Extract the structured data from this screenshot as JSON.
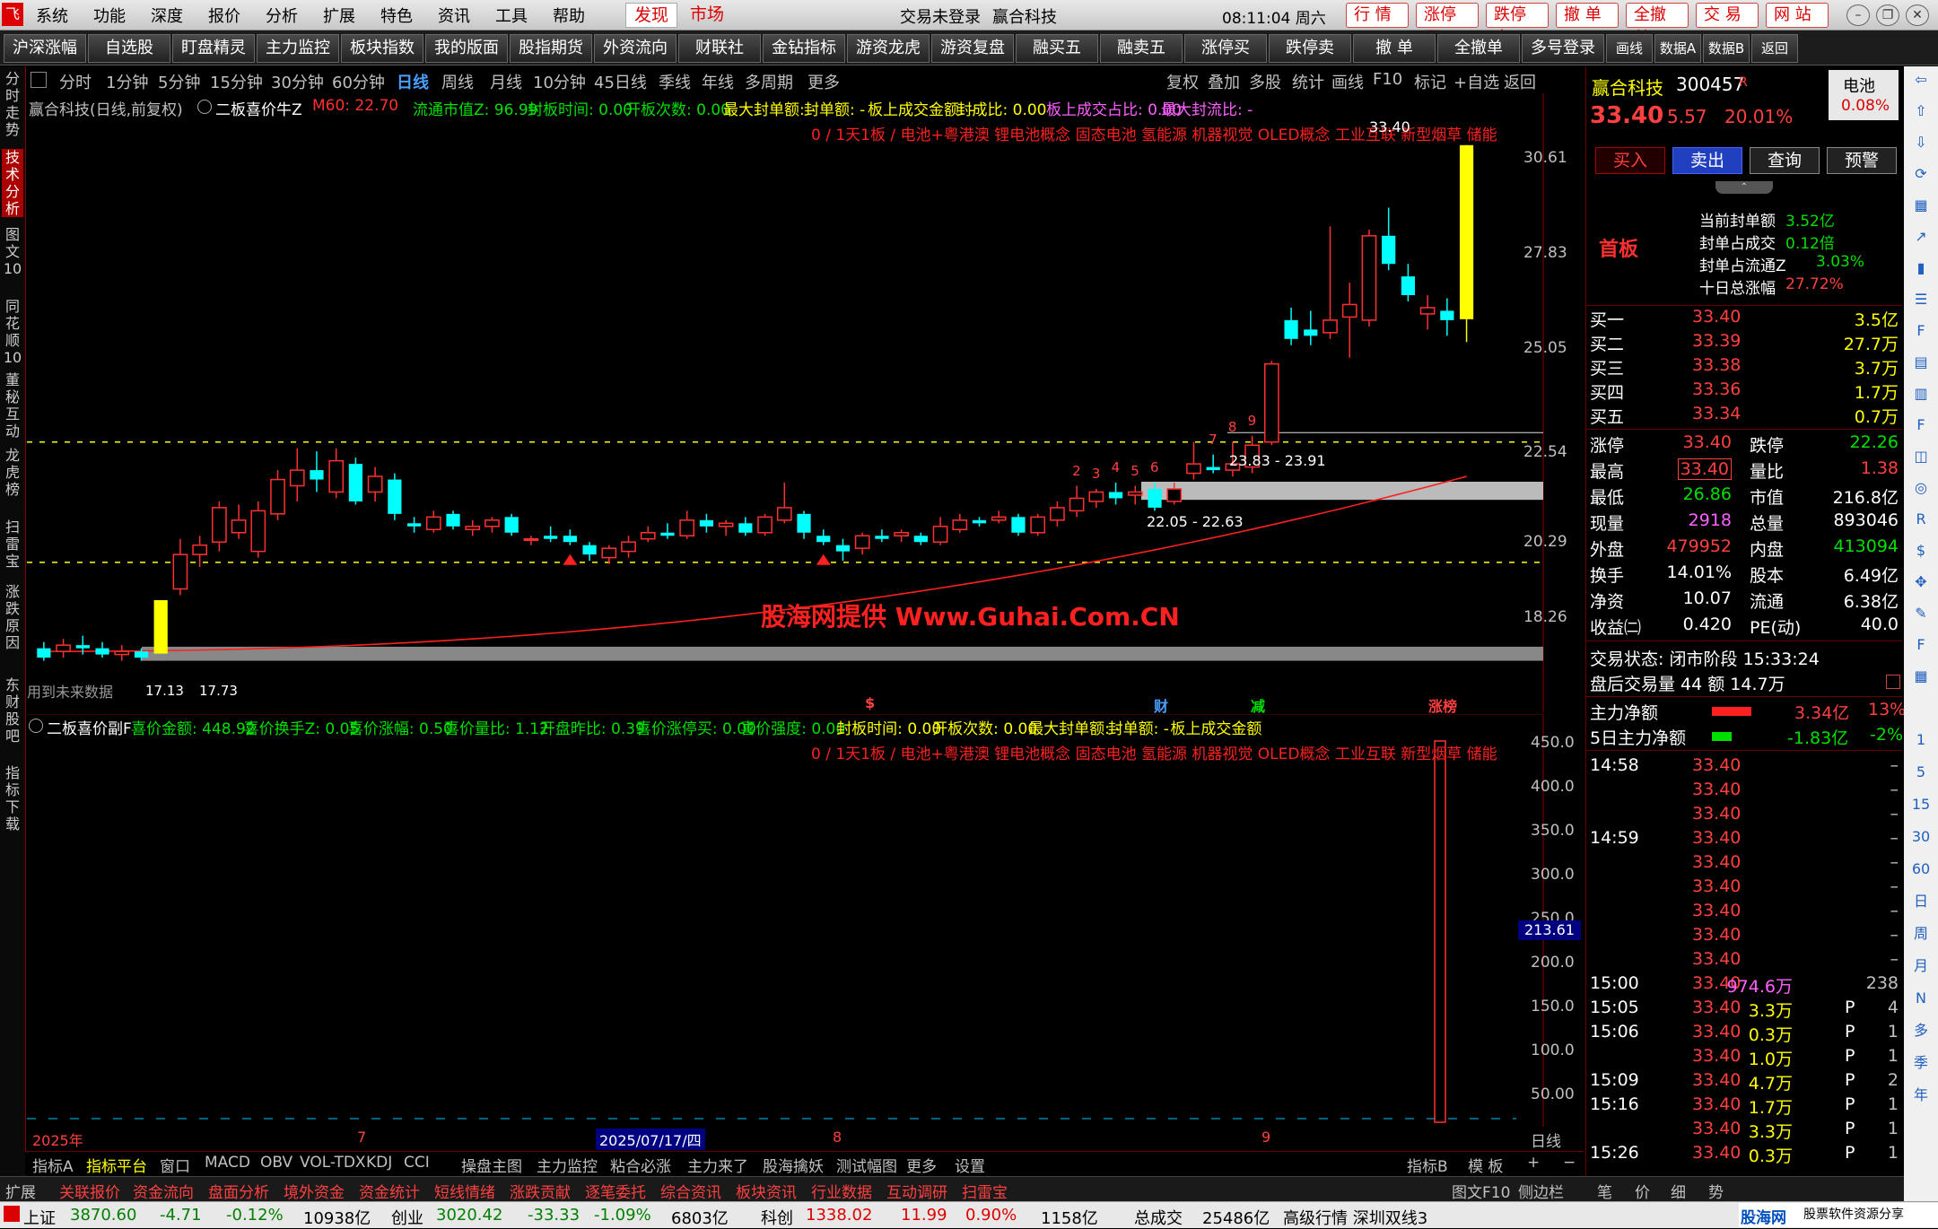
{
  "menu": {
    "items": [
      "系统",
      "功能",
      "深度",
      "报价",
      "分析",
      "扩展",
      "特色",
      "资讯",
      "工具",
      "帮助"
    ],
    "discover": "发现",
    "market": "市场",
    "login_status": "交易未登录",
    "stock_title": "赢合科技",
    "datetime": "08:11:04 周六",
    "right_buttons": [
      "行 情",
      "涨停买",
      "跌停卖",
      "撤 单",
      "全撤单",
      "交 易",
      "网 站"
    ]
  },
  "toolbar": {
    "buttons": [
      "沪深涨幅",
      "自选股",
      "盯盘精灵",
      "主力监控",
      "板块指数",
      "我的版面",
      "股指期货",
      "外资流向",
      "财联社",
      "金钻指标",
      "游资龙虎",
      "游资复盘",
      "融买五",
      "融卖五",
      "涨停买",
      "跌停卖",
      "撤 单",
      "全撤单",
      "多号登录",
      "画线",
      "数据A",
      "数据B",
      "返回"
    ]
  },
  "left_tabs": [
    "分时走势",
    "技术分析",
    "图文10",
    "同花顺10",
    "董秘互动",
    "龙虎榜",
    "扫雷宝",
    "涨跌原因",
    "东财股吧",
    "指标下载"
  ],
  "periods": {
    "items": [
      "分时",
      "1分钟",
      "5分钟",
      "15分钟",
      "30分钟",
      "60分钟",
      "日线",
      "周线",
      "月线",
      "10分钟",
      "45日线",
      "季线",
      "年线",
      "多周期",
      "更多"
    ],
    "active": "日线",
    "right_items": [
      "复权",
      "叠加",
      "多股",
      "统计",
      "画线",
      "F10",
      "标记",
      "+自选",
      "返回"
    ]
  },
  "main_chart": {
    "title": "赢合科技(日线,前复权)",
    "indicator": "二板喜价牛Z",
    "ma_label": "M60: 22.70",
    "info": [
      {
        "text": "流通市值Z: 96.99",
        "color": "#00e000"
      },
      {
        "text": "封板时间: 0.00",
        "color": "#00e000"
      },
      {
        "text": "开板次数: 0.00",
        "color": "#00e000"
      },
      {
        "text": "最大封单额: -",
        "color": "#ffff00"
      },
      {
        "text": "封单额: -",
        "color": "#ffff00"
      },
      {
        "text": "板上成交金额: -",
        "color": "#ffff00"
      },
      {
        "text": "封成比: 0.00",
        "color": "#ffff00"
      },
      {
        "text": "板上成交占比: 0.00",
        "color": "#ff60ff"
      },
      {
        "text": "最大封流比: -",
        "color": "#ff60ff"
      }
    ],
    "concepts": "0 / 1天1板 / 电池+粤港澳 锂电池概念 固态电池 氢能源 机器视觉 OLED概念 工业互联 新型烟草 储能",
    "y_ticks": [
      "30.61",
      "27.83",
      "25.05",
      "22.54",
      "20.29",
      "18.26"
    ],
    "peak_label": "33.40",
    "box1": "23.83 - 23.91",
    "box2": "22.05 - 22.63",
    "low_label": "17.13",
    "low_label2": "17.73",
    "future_label": "用到未来数据",
    "count_labels": [
      "7",
      "8",
      "9",
      "2",
      "3",
      "4",
      "5",
      "6"
    ],
    "watermark": "股海网提供 Www.Guhai.Com.CN",
    "markers": [
      "$",
      "财",
      "减",
      "涨榜"
    ]
  },
  "candles": [
    {
      "o": 17.3,
      "h": 17.5,
      "l": 16.9,
      "c": 17.0
    },
    {
      "o": 17.2,
      "h": 17.6,
      "l": 17.0,
      "c": 17.4
    },
    {
      "o": 17.4,
      "h": 17.7,
      "l": 17.1,
      "c": 17.3
    },
    {
      "o": 17.3,
      "h": 17.5,
      "l": 17.0,
      "c": 17.1
    },
    {
      "o": 17.1,
      "h": 17.4,
      "l": 16.9,
      "c": 17.2
    },
    {
      "o": 17.2,
      "h": 17.3,
      "l": 16.9,
      "c": 17.0
    },
    {
      "o": 17.13,
      "h": 18.84,
      "l": 17.13,
      "c": 18.84,
      "limit": true
    },
    {
      "o": 19.2,
      "h": 20.8,
      "l": 19.0,
      "c": 20.3
    },
    {
      "o": 20.3,
      "h": 20.9,
      "l": 19.9,
      "c": 20.6
    },
    {
      "o": 20.7,
      "h": 22.0,
      "l": 20.4,
      "c": 21.8
    },
    {
      "o": 21.0,
      "h": 21.9,
      "l": 20.8,
      "c": 21.4
    },
    {
      "o": 20.4,
      "h": 22.0,
      "l": 20.2,
      "c": 21.7
    },
    {
      "o": 21.6,
      "h": 23.0,
      "l": 21.4,
      "c": 22.7
    },
    {
      "o": 22.5,
      "h": 23.7,
      "l": 22.0,
      "c": 23.0
    },
    {
      "o": 23.0,
      "h": 23.6,
      "l": 22.3,
      "c": 22.7
    },
    {
      "o": 22.3,
      "h": 23.7,
      "l": 22.1,
      "c": 23.3
    },
    {
      "o": 23.2,
      "h": 23.4,
      "l": 21.9,
      "c": 22.0
    },
    {
      "o": 22.3,
      "h": 23.1,
      "l": 22.0,
      "c": 22.8
    },
    {
      "o": 22.7,
      "h": 22.9,
      "l": 21.4,
      "c": 21.6
    },
    {
      "o": 21.3,
      "h": 21.5,
      "l": 21.0,
      "c": 21.2
    },
    {
      "o": 21.1,
      "h": 21.7,
      "l": 21.0,
      "c": 21.5
    },
    {
      "o": 21.6,
      "h": 21.7,
      "l": 21.1,
      "c": 21.2
    },
    {
      "o": 21.1,
      "h": 21.4,
      "l": 20.9,
      "c": 21.2
    },
    {
      "o": 21.2,
      "h": 21.5,
      "l": 21.0,
      "c": 21.4
    },
    {
      "o": 21.5,
      "h": 21.6,
      "l": 20.9,
      "c": 21.0
    },
    {
      "o": 20.8,
      "h": 20.9,
      "l": 20.6,
      "c": 20.8
    },
    {
      "o": 20.9,
      "h": 21.2,
      "l": 20.7,
      "c": 20.8
    },
    {
      "o": 20.9,
      "h": 21.1,
      "l": 20.6,
      "c": 20.7
    },
    {
      "o": 20.6,
      "h": 20.7,
      "l": 20.1,
      "c": 20.3
    },
    {
      "o": 20.2,
      "h": 20.6,
      "l": 20.0,
      "c": 20.5
    },
    {
      "o": 20.4,
      "h": 20.9,
      "l": 20.2,
      "c": 20.7
    },
    {
      "o": 20.8,
      "h": 21.2,
      "l": 20.7,
      "c": 21.0
    },
    {
      "o": 21.0,
      "h": 21.3,
      "l": 20.8,
      "c": 20.9
    },
    {
      "o": 20.9,
      "h": 21.7,
      "l": 20.8,
      "c": 21.4
    },
    {
      "o": 21.4,
      "h": 21.6,
      "l": 21.0,
      "c": 21.2
    },
    {
      "o": 21.2,
      "h": 21.4,
      "l": 20.9,
      "c": 21.3
    },
    {
      "o": 21.3,
      "h": 21.5,
      "l": 20.9,
      "c": 21.0
    },
    {
      "o": 21.0,
      "h": 21.6,
      "l": 20.9,
      "c": 21.5
    },
    {
      "o": 21.4,
      "h": 22.6,
      "l": 21.3,
      "c": 21.8
    },
    {
      "o": 21.6,
      "h": 21.7,
      "l": 20.8,
      "c": 21.0
    },
    {
      "o": 20.9,
      "h": 21.1,
      "l": 20.6,
      "c": 20.7
    },
    {
      "o": 20.6,
      "h": 20.8,
      "l": 20.1,
      "c": 20.4
    },
    {
      "o": 20.5,
      "h": 21.0,
      "l": 20.3,
      "c": 20.9
    },
    {
      "o": 20.9,
      "h": 21.1,
      "l": 20.7,
      "c": 20.8
    },
    {
      "o": 20.9,
      "h": 21.1,
      "l": 20.7,
      "c": 21.0
    },
    {
      "o": 20.9,
      "h": 21.0,
      "l": 20.6,
      "c": 20.7
    },
    {
      "o": 20.7,
      "h": 21.5,
      "l": 20.6,
      "c": 21.2
    },
    {
      "o": 21.1,
      "h": 21.6,
      "l": 21.0,
      "c": 21.4
    },
    {
      "o": 21.4,
      "h": 21.5,
      "l": 21.2,
      "c": 21.3
    },
    {
      "o": 21.4,
      "h": 21.7,
      "l": 21.3,
      "c": 21.5
    },
    {
      "o": 21.5,
      "h": 21.6,
      "l": 20.9,
      "c": 21.0
    },
    {
      "o": 21.0,
      "h": 21.6,
      "l": 20.9,
      "c": 21.5
    },
    {
      "o": 21.4,
      "h": 22.0,
      "l": 21.2,
      "c": 21.8
    },
    {
      "o": 21.7,
      "h": 22.5,
      "l": 21.5,
      "c": 22.1
    },
    {
      "o": 22.0,
      "h": 22.4,
      "l": 21.8,
      "c": 22.3
    },
    {
      "o": 22.3,
      "h": 22.6,
      "l": 21.9,
      "c": 22.1
    },
    {
      "o": 22.2,
      "h": 22.5,
      "l": 21.9,
      "c": 22.3
    },
    {
      "o": 22.4,
      "h": 22.6,
      "l": 21.7,
      "c": 21.8
    },
    {
      "o": 22.0,
      "h": 22.6,
      "l": 21.9,
      "c": 22.4
    },
    {
      "o": 22.9,
      "h": 23.9,
      "l": 22.7,
      "c": 23.2
    },
    {
      "o": 23.1,
      "h": 23.5,
      "l": 22.9,
      "c": 23.0
    },
    {
      "o": 23.0,
      "h": 23.9,
      "l": 22.8,
      "c": 23.2
    },
    {
      "o": 23.1,
      "h": 24.1,
      "l": 22.9,
      "c": 23.8
    },
    {
      "o": 23.9,
      "h": 26.5,
      "l": 23.8,
      "c": 26.4
    },
    {
      "o": 27.8,
      "h": 28.2,
      "l": 27.0,
      "c": 27.2
    },
    {
      "o": 27.5,
      "h": 28.1,
      "l": 27.0,
      "c": 27.3
    },
    {
      "o": 27.4,
      "h": 30.8,
      "l": 27.2,
      "c": 27.8
    },
    {
      "o": 27.9,
      "h": 29.0,
      "l": 26.6,
      "c": 28.3
    },
    {
      "o": 27.8,
      "h": 30.7,
      "l": 27.6,
      "c": 30.5
    },
    {
      "o": 30.5,
      "h": 31.4,
      "l": 29.4,
      "c": 29.6
    },
    {
      "o": 29.2,
      "h": 29.6,
      "l": 28.4,
      "c": 28.6
    },
    {
      "o": 28.0,
      "h": 28.6,
      "l": 27.5,
      "c": 28.2
    },
    {
      "o": 28.1,
      "h": 28.5,
      "l": 27.3,
      "c": 27.8
    },
    {
      "o": 27.83,
      "h": 33.4,
      "l": 27.1,
      "c": 33.4,
      "limit": true
    }
  ],
  "sub_chart": {
    "indicator": "二板喜价副F",
    "info": [
      {
        "text": "喜价金额: 448.92",
        "color": "#00e000"
      },
      {
        "text": "喜价换手Z: 0.05",
        "color": "#00e000"
      },
      {
        "text": "喜价涨幅: 0.50",
        "color": "#00e000"
      },
      {
        "text": "喜价量比: 1.12",
        "color": "#00e000"
      },
      {
        "text": "开盘昨比: 0.39",
        "color": "#00e000"
      },
      {
        "text": "喜价涨停买: 0.00",
        "color": "#00e000"
      },
      {
        "text": "喜价强度: 0.00",
        "color": "#00e000"
      },
      {
        "text": "封板时间: 0.00",
        "color": "#ffff00"
      },
      {
        "text": "开板次数: 0.00",
        "color": "#ffff00"
      },
      {
        "text": "最大封单额: -",
        "color": "#ffff00"
      },
      {
        "text": "封单额: -",
        "color": "#ffff00"
      },
      {
        "text": "板上成交金额",
        "color": "#ffff00"
      }
    ],
    "y_ticks": [
      "450.0",
      "400.0",
      "350.0",
      "300.0",
      "250.0",
      "200.0",
      "150.0",
      "100.0",
      "50.00"
    ],
    "current_value": "213.61",
    "spike_value": 448.92
  },
  "x_axis": {
    "labels": [
      "2025年",
      "7",
      "2025/07/17/四",
      "8",
      "9"
    ],
    "period": "日线"
  },
  "indicator_tabs": [
    "指标A",
    "指标平台",
    "窗口",
    "MACD",
    "OBV",
    "VOL-TDX",
    "KDJ",
    "CCI",
    "操盘主图",
    "主力监控",
    "粘合必涨",
    "主力来了",
    "股海擒妖",
    "测试幅图",
    "更多",
    "设置"
  ],
  "indicator_right": [
    "指标B",
    "模 板",
    "+",
    "−"
  ],
  "func_tabs": [
    "扩展",
    "关联报价",
    "资金流向",
    "盘面分析",
    "境外资金",
    "资金统计",
    "短线情绪",
    "涨跌贡献",
    "逐笔委托",
    "综合资讯",
    "板块资讯",
    "行业数据",
    "互动调研",
    "扫雷宝"
  ],
  "func_right": [
    "图文F10",
    "侧边栏",
    "笔",
    "价",
    "细",
    "势"
  ],
  "status": {
    "sh_label": "上证",
    "sh_value": "3870.60",
    "sh_change": "-4.71",
    "sh_pct": "-0.12%",
    "sh_amount": "10938亿",
    "cy_label": "创业",
    "cy_value": "3020.42",
    "cy_change": "-33.33",
    "cy_pct": "-1.09%",
    "cy_amount": "6803亿",
    "kc_label": "科创",
    "kc_value": "1338.02",
    "kc_change": "11.99",
    "kc_pct": "0.90%",
    "kc_amount": "1158亿",
    "total_label": "总成交",
    "total_value": "25486亿",
    "feed": "高级行情 深圳双线3",
    "brand": "股海网",
    "brand_sub": "股票软件资源分享",
    "brand_url": "www.Guhai.com.cn"
  },
  "quote": {
    "name": "赢合科技",
    "code": "300457",
    "tag": "R",
    "sector": "电池",
    "sector_pct": "0.08%",
    "price": "33.40",
    "change": "5.57",
    "pct": "20.01%",
    "buttons": [
      "买入",
      "卖出",
      "查询",
      "预警"
    ],
    "board": "首板",
    "seal_info": [
      {
        "label": "当前封单额",
        "value": "3.52亿"
      },
      {
        "label": "封单占成交",
        "value": "0.12倍"
      },
      {
        "label": "封单占流通Z",
        "value": "3.03%"
      },
      {
        "label": "十日总涨幅",
        "value": "27.72%"
      }
    ],
    "bids": [
      {
        "label": "买一",
        "price": "33.40",
        "vol": "3.5亿"
      },
      {
        "label": "买二",
        "price": "33.39",
        "vol": "27.7万"
      },
      {
        "label": "买三",
        "price": "33.38",
        "vol": "3.7万"
      },
      {
        "label": "买四",
        "price": "33.36",
        "vol": "1.7万"
      },
      {
        "label": "买五",
        "price": "33.34",
        "vol": "0.7万"
      }
    ],
    "stats": [
      {
        "l1": "涨停",
        "v1": "33.40",
        "c1": "red",
        "l2": "跌停",
        "v2": "22.26",
        "c2": "green"
      },
      {
        "l1": "最高",
        "v1": "33.40",
        "c1": "red",
        "l2": "量比",
        "v2": "1.38",
        "c2": "red"
      },
      {
        "l1": "最低",
        "v1": "26.86",
        "c1": "green",
        "l2": "市值",
        "v2": "216.8亿",
        "c2": "white"
      },
      {
        "l1": "现量",
        "v1": "2918",
        "c1": "magenta",
        "l2": "总量",
        "v2": "893046",
        "c2": "white"
      },
      {
        "l1": "外盘",
        "v1": "479952",
        "c1": "red",
        "l2": "内盘",
        "v2": "413094",
        "c2": "green"
      },
      {
        "l1": "换手",
        "v1": "14.01%",
        "c1": "white",
        "l2": "股本",
        "v2": "6.49亿",
        "c2": "white"
      },
      {
        "l1": "净资",
        "v1": "10.07",
        "c1": "white",
        "l2": "流通",
        "v2": "6.38亿",
        "c2": "white"
      },
      {
        "l1": "收益㈡",
        "v1": "0.420",
        "c1": "white",
        "l2": "PE(动)",
        "v2": "40.0",
        "c2": "white"
      }
    ],
    "trade_state": "交易状态: 闭市阶段 15:33:24",
    "after_hours": "盘后交易量 44 额 14.7万",
    "main_flow_label": "主力净额",
    "main_flow": "3.34亿",
    "main_flow_pct": "13%",
    "flow5_label": "5日主力净额",
    "flow5": "-1.83亿",
    "flow5_pct": "-2%",
    "ticks": [
      {
        "t": "14:58",
        "p": "33.40",
        "v": "",
        "d": "",
        "n": "–"
      },
      {
        "t": "",
        "p": "33.40",
        "v": "",
        "d": "",
        "n": "–"
      },
      {
        "t": "",
        "p": "33.40",
        "v": "",
        "d": "",
        "n": "–"
      },
      {
        "t": "14:59",
        "p": "33.40",
        "v": "",
        "d": "",
        "n": "–"
      },
      {
        "t": "",
        "p": "33.40",
        "v": "",
        "d": "",
        "n": "–"
      },
      {
        "t": "",
        "p": "33.40",
        "v": "",
        "d": "",
        "n": "–"
      },
      {
        "t": "",
        "p": "33.40",
        "v": "",
        "d": "",
        "n": "–"
      },
      {
        "t": "",
        "p": "33.40",
        "v": "",
        "d": "",
        "n": "–"
      },
      {
        "t": "",
        "p": "33.40",
        "v": "",
        "d": "",
        "n": "–"
      },
      {
        "t": "15:00",
        "p": "33.40",
        "v": "974.6万",
        "d": "",
        "n": "238"
      },
      {
        "t": "15:05",
        "p": "33.40",
        "v": "3.3万",
        "d": "P",
        "n": "4"
      },
      {
        "t": "15:06",
        "p": "33.40",
        "v": "0.3万",
        "d": "P",
        "n": "1"
      },
      {
        "t": "",
        "p": "33.40",
        "v": "1.0万",
        "d": "P",
        "n": "1"
      },
      {
        "t": "15:09",
        "p": "33.40",
        "v": "4.7万",
        "d": "P",
        "n": "2"
      },
      {
        "t": "15:16",
        "p": "33.40",
        "v": "1.7万",
        "d": "P",
        "n": "1"
      },
      {
        "t": "",
        "p": "33.40",
        "v": "3.3万",
        "d": "P",
        "n": "1"
      },
      {
        "t": "15:26",
        "p": "33.40",
        "v": "0.3万",
        "d": "P",
        "n": "1"
      }
    ]
  },
  "right_strip": [
    "1",
    "5",
    "15",
    "30",
    "60",
    "日",
    "周",
    "月",
    "N",
    "多",
    "季",
    "年"
  ]
}
